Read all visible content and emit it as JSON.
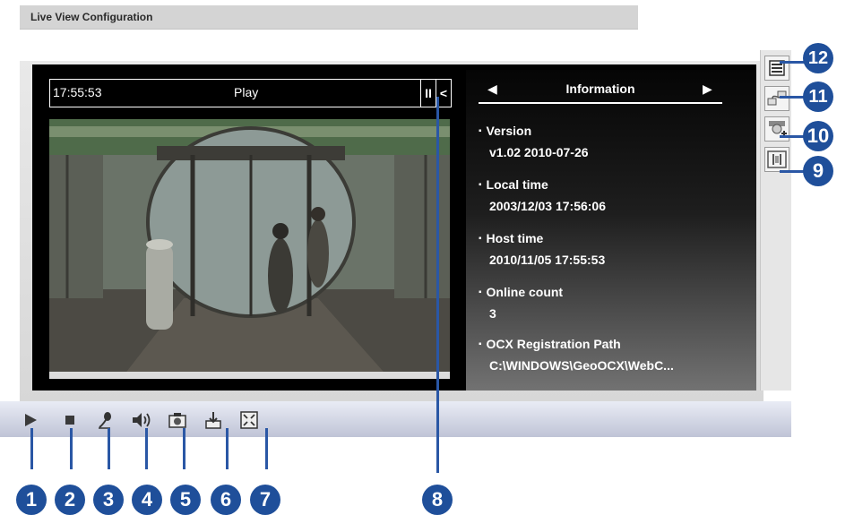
{
  "page_title": "Live View Configuration",
  "status_bar": {
    "time": "17:55:53",
    "state": "Play",
    "pause_glyph": "II",
    "collapse_glyph": "<"
  },
  "info": {
    "header": "Information",
    "prev_glyph": "◀",
    "next_glyph": "▶",
    "items": [
      {
        "label": "Version",
        "value": "v1.02  2010-07-26"
      },
      {
        "label": "Local time",
        "value": "2003/12/03 17:56:06"
      },
      {
        "label": "Host time",
        "value": "2010/11/05 17:55:53"
      },
      {
        "label": "Online count",
        "value": "3"
      },
      {
        "label": "OCX Registration Path",
        "value": "C:\\WINDOWS\\GeoOCX\\WebC..."
      }
    ]
  },
  "toolbar": {
    "buttons": [
      {
        "name": "play",
        "icon": "play-icon"
      },
      {
        "name": "stop",
        "icon": "stop-icon"
      },
      {
        "name": "microphone",
        "icon": "microphone-icon"
      },
      {
        "name": "speaker",
        "icon": "speaker-icon"
      },
      {
        "name": "snapshot",
        "icon": "camera-icon"
      },
      {
        "name": "save",
        "icon": "save-icon"
      },
      {
        "name": "fullscreen",
        "icon": "fullscreen-icon"
      }
    ]
  },
  "side_buttons": [
    {
      "name": "information",
      "icon": "list-icon"
    },
    {
      "name": "connection",
      "icon": "connect-icon"
    },
    {
      "name": "ptz",
      "icon": "ptz-camera-icon"
    },
    {
      "name": "io",
      "icon": "io-icon"
    }
  ],
  "callouts": [
    "1",
    "2",
    "3",
    "4",
    "5",
    "6",
    "7",
    "8",
    "9",
    "10",
    "11",
    "12"
  ],
  "colors": {
    "callout": "#1f4f9a",
    "toolbar_top": "#e9ecf5",
    "toolbar_bottom": "#bfc4d6",
    "viewer": "#000000"
  }
}
